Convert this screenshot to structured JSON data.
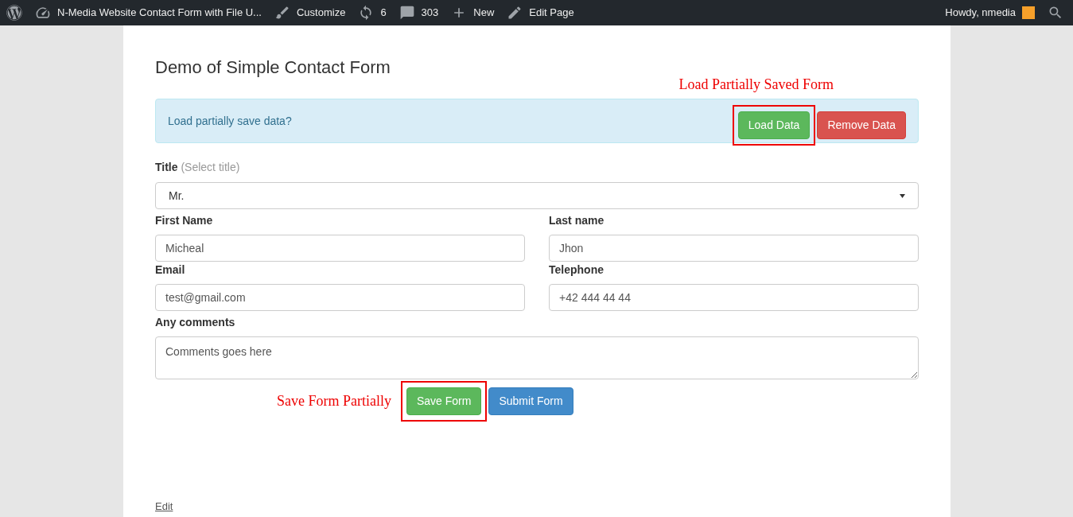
{
  "admin_bar": {
    "site": "N-Media Website Contact Form with File U...",
    "items": [
      {
        "kind": "customize",
        "label": "Customize"
      },
      {
        "kind": "updates",
        "label": "6"
      },
      {
        "kind": "comments",
        "label": "303"
      },
      {
        "kind": "new",
        "label": "New"
      },
      {
        "kind": "edit",
        "label": "Edit Page"
      }
    ],
    "greeting": "Howdy, nmedia"
  },
  "page": {
    "title": "Demo of Simple Contact Form",
    "alert": {
      "message": "Load partially save data?",
      "annotation": "Load Partially Saved Form",
      "buttons": [
        {
          "kind": "success",
          "label": "Load Data",
          "highlighted": true
        },
        {
          "kind": "danger",
          "label": "Remove Data",
          "highlighted": false
        }
      ]
    },
    "title_field": {
      "label": "Title",
      "hint": "(Select title)",
      "value": "Mr."
    },
    "fields": [
      {
        "label": "First Name",
        "value": "Micheal"
      },
      {
        "label": "Last name",
        "value": "Jhon"
      },
      {
        "label": "Email",
        "value": "test@gmail.com"
      },
      {
        "label": "Telephone",
        "value": "+42 444 44 44"
      }
    ],
    "comments": {
      "label": "Any comments",
      "placeholder": "Comments goes here"
    },
    "annotation": "Save Form Partially",
    "buttons": [
      {
        "kind": "success",
        "label": "Save Form",
        "highlighted": true
      },
      {
        "kind": "primary",
        "label": "Submit Form",
        "highlighted": false
      }
    ],
    "edit_link": "Edit"
  }
}
